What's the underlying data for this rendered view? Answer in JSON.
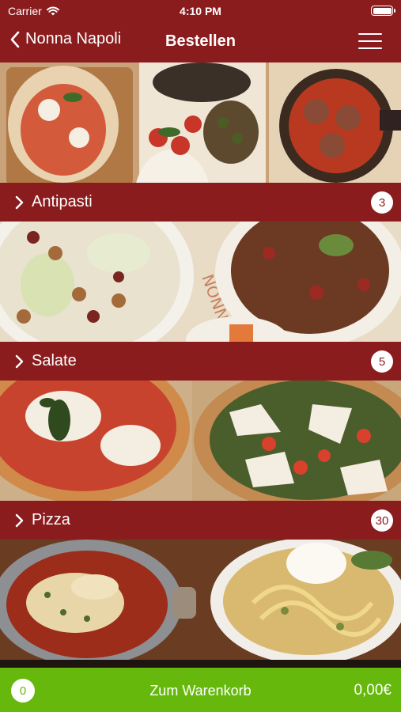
{
  "status_bar": {
    "carrier": "Carrier",
    "time": "4:10 PM"
  },
  "nav": {
    "back_label": "Nonna Napoli",
    "title": "Bestellen"
  },
  "categories": [
    {
      "label": "Antipasti",
      "count": "3"
    },
    {
      "label": "Salate",
      "count": "5"
    },
    {
      "label": "Pizza",
      "count": "30"
    }
  ],
  "cart": {
    "count": "0",
    "label": "Zum Warenkorb",
    "total": "0,00€"
  },
  "colors": {
    "header": "#8b1c1e",
    "cart": "#66b90c",
    "badge_text": "#8b1c1e"
  }
}
